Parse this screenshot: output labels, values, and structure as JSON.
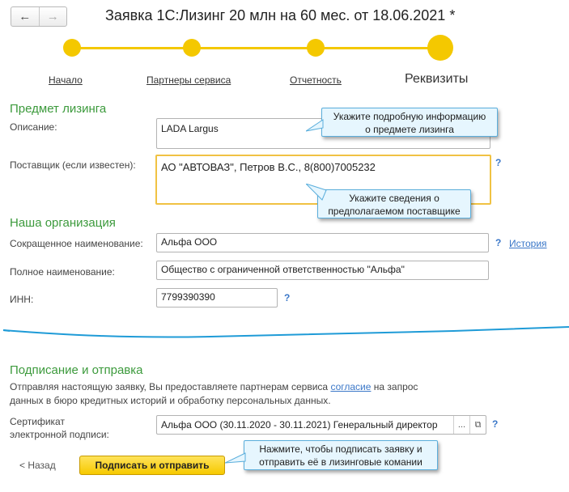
{
  "nav": {
    "back_glyph": "←",
    "forward_glyph": "→"
  },
  "title": "Заявка 1С:Лизинг 20 млн на 60 мес. от 18.06.2021 *",
  "steps": [
    {
      "label": "Начало"
    },
    {
      "label": "Партнеры сервиса"
    },
    {
      "label": "Отчетность"
    },
    {
      "label": "Реквизиты"
    }
  ],
  "subject": {
    "section_title": "Предмет лизинга",
    "description_label": "Описание:",
    "description_value": "LADA Largus",
    "supplier_label": "Поставщик (если известен):",
    "supplier_value": "АО \"АВТОВАЗ\", Петров В.С., 8(800)7005232"
  },
  "callouts": {
    "description_line1": "Укажите подробную информацию",
    "description_line2": "о предмете лизинга",
    "supplier_line1": "Укажите сведения о",
    "supplier_line2": "предполагаемом поставщике",
    "sign_line1": "Нажмите, чтобы подписать заявку и",
    "sign_line2": "отправить её в лизинговые комании"
  },
  "org": {
    "section_title": "Наша организация",
    "short_name_label": "Сокращенное наименование:",
    "short_name_value": "Альфа ООО",
    "history_link": "История",
    "full_name_label": "Полное наименование:",
    "full_name_value": "Общество с ограниченной ответственностью \"Альфа\"",
    "inn_label": "ИНН:",
    "inn_value": "7799390390"
  },
  "help_glyph": "?",
  "signing": {
    "section_title": "Подписание и отправка",
    "text_before": "Отправляя настоящую заявку, Вы предоставляете партнерам сервиса ",
    "consent_link": "согласие",
    "text_after_line1": " на запрос",
    "text_line2": "данных в бюро кредитных историй и обработку персональных данных.",
    "cert_label_line1": "Сертификат",
    "cert_label_line2": "электронной подписи:",
    "cert_value": "Альфа ООО (30.11.2020 - 30.11.2021) Генеральный директор",
    "cert_select_glyph": "...",
    "cert_open_glyph": "⧉",
    "back_label": "< Назад",
    "submit_label": "Подписать и отправить"
  },
  "colors": {
    "accent_yellow": "#f4c800",
    "section_green": "#3c9a3c",
    "link_blue": "#3a77c8",
    "callout_bg": "#e6f6fe",
    "callout_border": "#5aaedc",
    "wave_blue": "#1f9bd7"
  }
}
